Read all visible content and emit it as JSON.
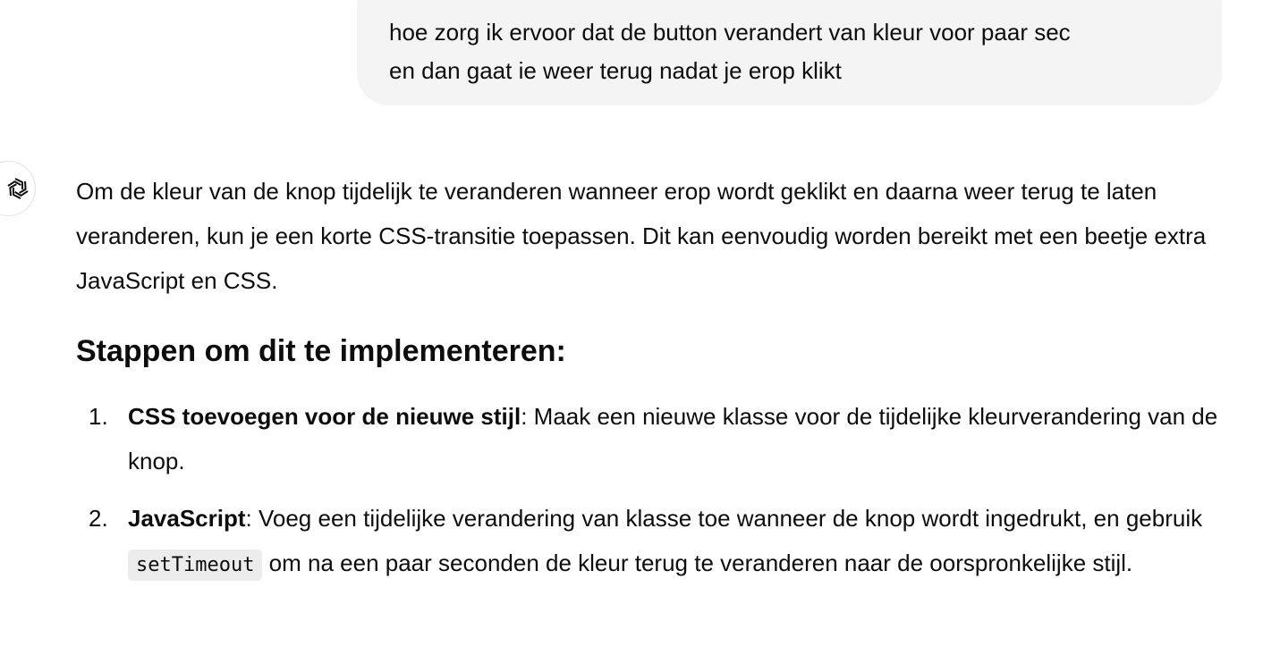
{
  "user_message": {
    "text": " hoe zorg ik ervoor dat de button verandert van kleur voor paar sec\nen dan gaat ie weer terug nadat je erop klikt"
  },
  "assistant": {
    "avatar_icon": "openai-logo-icon",
    "intro": "Om de kleur van de knop tijdelijk te veranderen wanneer erop wordt geklikt en daarna weer terug te laten veranderen, kun je een korte CSS-transitie toepassen. Dit kan eenvoudig worden bereikt met een beetje extra JavaScript en CSS.",
    "heading": "Stappen om dit te implementeren:",
    "steps": [
      {
        "number": "1.",
        "title": "CSS toevoegen voor de nieuwe stijl",
        "text": ": Maak een nieuwe klasse voor de tijdelijke kleurverandering van de knop."
      },
      {
        "number": "2.",
        "title": "JavaScript",
        "text_before": ": Voeg een tijdelijke verandering van klasse toe wanneer de knop wordt ingedrukt, en gebruik ",
        "code": "setTimeout",
        "text_after": " om na een paar seconden de kleur terug te veranderen naar de oorspronkelijke stijl."
      }
    ]
  }
}
